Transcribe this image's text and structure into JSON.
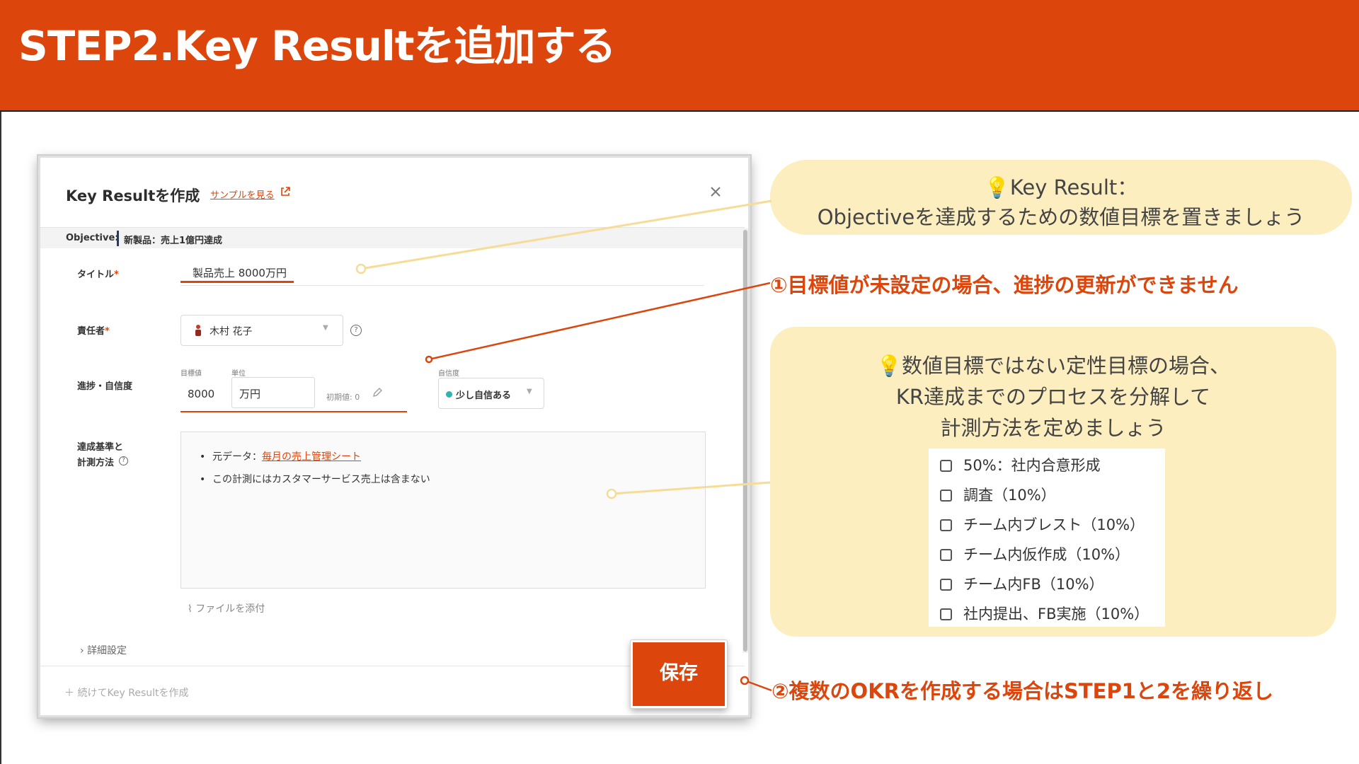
{
  "slide": {
    "title": "STEP2.Key Resultを追加する"
  },
  "modal": {
    "title": "Key Resultを作成",
    "sample_link": "サンプルを見る",
    "objective_label": "Objective:",
    "objective_value": "新製品：売上1億円達成",
    "fields": {
      "title_label": "タイトル",
      "title_value": "製品売上 8000万円",
      "owner_label": "責任者",
      "owner_value": "木村 花子",
      "progress_label": "進捗・自信度",
      "target_label": "目標値",
      "target_value": "8000",
      "unit_label": "単位",
      "unit_value": "万円",
      "initial_value": "初期値: 0",
      "confidence_label": "自信度",
      "confidence_value": "少し自信ある",
      "criteria_label_1": "達成基準と",
      "criteria_label_2": "計測方法",
      "required_mark": "*"
    },
    "criteria": {
      "item1_prefix": "元データ：",
      "item1_link": "毎月の売上管理シート",
      "item2": "この計測にはカスタマーサービス売上は含まない"
    },
    "attach_file": "ファイルを添付",
    "detail_settings": "詳細設定",
    "continue_create": "続けてKey Resultを作成",
    "save_button": "保存",
    "confidence_color": "#2eb3b1"
  },
  "callouts": {
    "kr_definition_line1": "Key Result：",
    "kr_definition_line2": "Objectiveを達成するための数値目標を置きましょう",
    "note1": "①目標値が未設定の場合、進捗の更新ができません",
    "qualitative_line1": "数値目標ではない定性目標の場合、",
    "qualitative_line2": "KR達成までのプロセスを分解して",
    "qualitative_line3": "計測方法を定めましょう",
    "checklist": [
      "50%：社内合意形成",
      "調査（10%）",
      "チーム内ブレスト（10%）",
      "チーム内仮作成（10%）",
      "チーム内FB（10%）",
      "社内提出、FB実施（10%）"
    ],
    "note2": "②複数のOKRを作成する場合はSTEP1と2を繰り返し"
  },
  "colors": {
    "brand": "#dc460c",
    "callout_bg": "#fdeec0"
  }
}
